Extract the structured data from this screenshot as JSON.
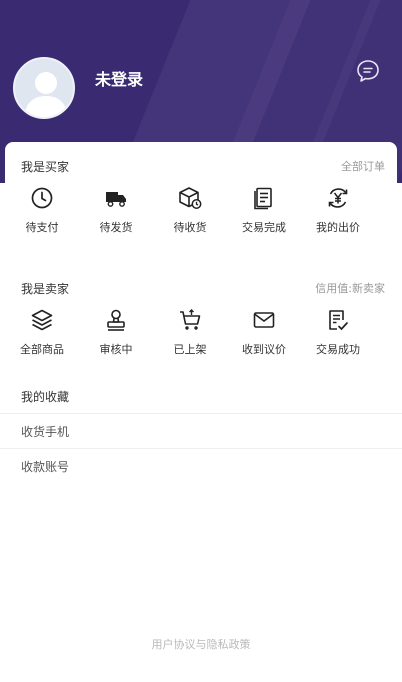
{
  "header": {
    "username": "未登录",
    "bg_color": "#3a2a72",
    "message_icon": "chat-bubble-icon"
  },
  "buyer": {
    "title": "我是买家",
    "link": "全部订单",
    "items": [
      {
        "label": "待支付",
        "icon": "clock-icon"
      },
      {
        "label": "待发货",
        "icon": "truck-icon"
      },
      {
        "label": "待收货",
        "icon": "package-icon"
      },
      {
        "label": "交易完成",
        "icon": "document-icon"
      },
      {
        "label": "我的出价",
        "icon": "yen-refresh-icon"
      }
    ]
  },
  "seller": {
    "title": "我是卖家",
    "link": "信用值:新卖家",
    "items": [
      {
        "label": "全部商品",
        "icon": "layers-icon"
      },
      {
        "label": "审核中",
        "icon": "stamp-icon"
      },
      {
        "label": "已上架",
        "icon": "cart-icon"
      },
      {
        "label": "收到议价",
        "icon": "mail-icon"
      },
      {
        "label": "交易成功",
        "icon": "check-document-icon"
      }
    ]
  },
  "list": [
    {
      "label": "我的收藏"
    },
    {
      "label": "收货手机"
    },
    {
      "label": "收款账号"
    }
  ],
  "footer": {
    "policy_link": "用户协议与隐私政策"
  }
}
